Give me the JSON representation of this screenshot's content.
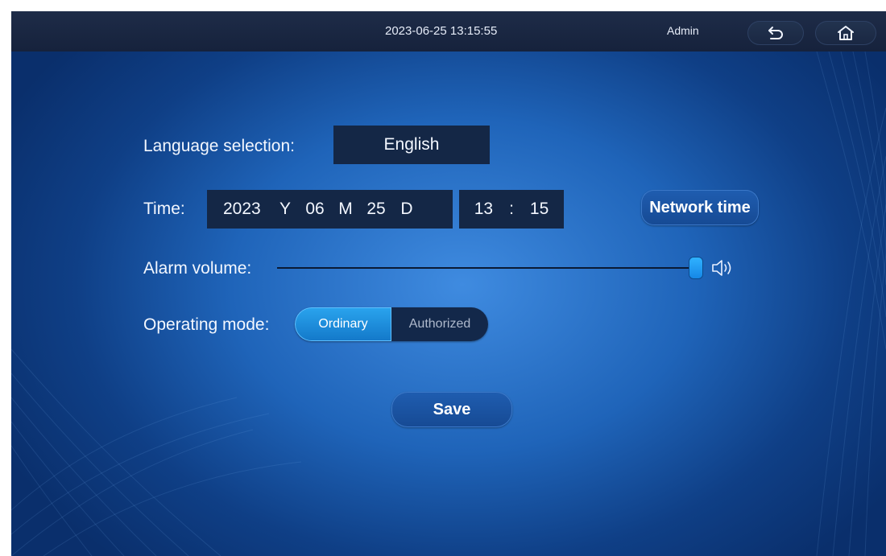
{
  "header": {
    "datetime": "2023-06-25 13:15:55",
    "user": "Admin",
    "back_icon": "back-arrow-icon",
    "home_icon": "home-icon"
  },
  "language": {
    "label": "Language selection:",
    "value": "English"
  },
  "time": {
    "label": "Time:",
    "year": "2023",
    "year_unit": "Y",
    "month": "06",
    "month_unit": "M",
    "day": "25",
    "day_unit": "D",
    "hour": "13",
    "separator": ":",
    "minute": "15",
    "network_button": "Network time"
  },
  "alarm": {
    "label": "Alarm volume:",
    "volume_level": 1.0,
    "icon": "speaker-icon"
  },
  "mode": {
    "label": "Operating mode:",
    "options": [
      "Ordinary",
      "Authorized"
    ],
    "selected": "Ordinary"
  },
  "actions": {
    "save_label": "Save"
  },
  "colors": {
    "accent": "#1f8ae8",
    "background": "#1f64b9",
    "dark_field": "#142746"
  }
}
